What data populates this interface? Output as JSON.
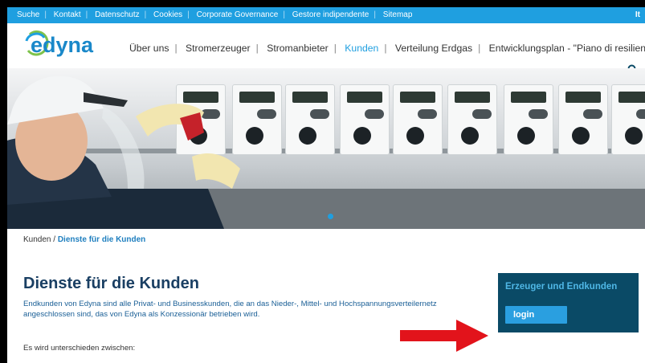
{
  "topbar": {
    "links": [
      "Suche",
      "Kontakt",
      "Datenschutz",
      "Cookies",
      "Corporate Governance",
      "Gestore indipendente",
      "Sitemap"
    ],
    "lang": "It"
  },
  "brand": {
    "name": "edyna",
    "color": "#1a88c9"
  },
  "nav": {
    "items": [
      "Über uns",
      "Stromerzeuger",
      "Stromanbieter",
      "Kunden",
      "Verteilung Erdgas",
      "Entwicklungsplan - \"Piano di resilienza\""
    ],
    "active_index": 3
  },
  "breadcrumb": {
    "parent": "Kunden",
    "current": "Dienste für die Kunden"
  },
  "page": {
    "title": "Dienste für die Kunden",
    "intro": "Endkunden von Edyna sind alle Privat- und Businesskunden, die an das Nieder-, Mittel- und Hochspannungsverteilernetz angeschlossen sind, das von Edyna als Konzessionär betrieben wird.",
    "distinguish": "Es wird unterschieden zwischen:"
  },
  "sidebox": {
    "heading": "Erzeuger und Endkunden",
    "login_label": "login"
  },
  "colors": {
    "accent": "#1f9fe0",
    "dark_panel": "#0a4a66",
    "arrow": "#e2131b"
  }
}
